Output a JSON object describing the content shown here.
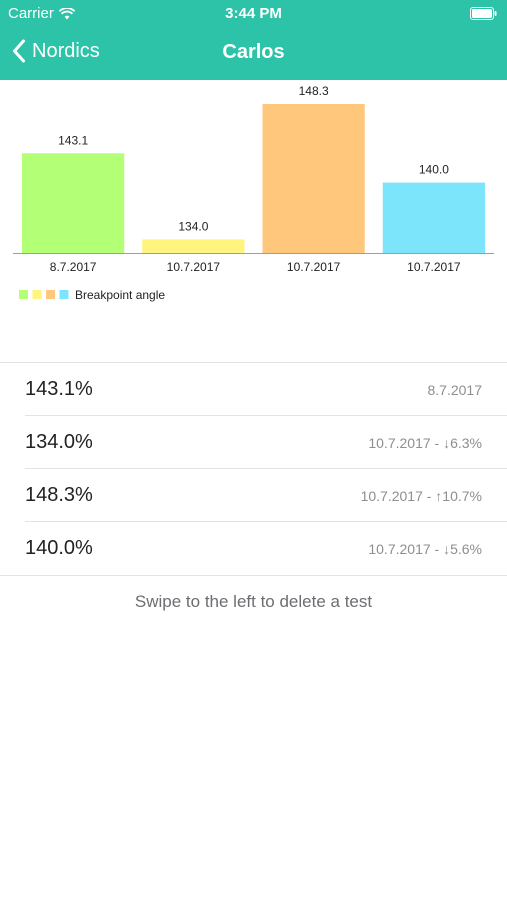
{
  "status_bar": {
    "carrier": "Carrier",
    "time": "3:44 PM"
  },
  "nav": {
    "back_label": "Nordics",
    "title": "Carlos"
  },
  "chart_data": {
    "type": "bar",
    "categories": [
      "8.7.2017",
      "10.7.2017",
      "10.7.2017",
      "10.7.2017"
    ],
    "values": [
      143.1,
      134.0,
      148.3,
      140.0
    ],
    "value_labels": [
      "143.1",
      "134.0",
      "148.3",
      "140.0"
    ],
    "colors": [
      "#b3ff75",
      "#fff47d",
      "#ffc77c",
      "#7ce4fb"
    ],
    "series": [
      {
        "name": "Breakpoint angle",
        "values": [
          143.1,
          134.0,
          148.3,
          140.0
        ]
      }
    ],
    "legend_position": "bottom-left",
    "grid": false
  },
  "tests": [
    {
      "value": "143.1%",
      "detail": "8.7.2017"
    },
    {
      "value": "134.0%",
      "detail": "10.7.2017 - ↓6.3%"
    },
    {
      "value": "148.3%",
      "detail": "10.7.2017 - ↑10.7%"
    },
    {
      "value": "140.0%",
      "detail": "10.7.2017 - ↓5.6%"
    }
  ],
  "hint": "Swipe to the left to delete a test"
}
